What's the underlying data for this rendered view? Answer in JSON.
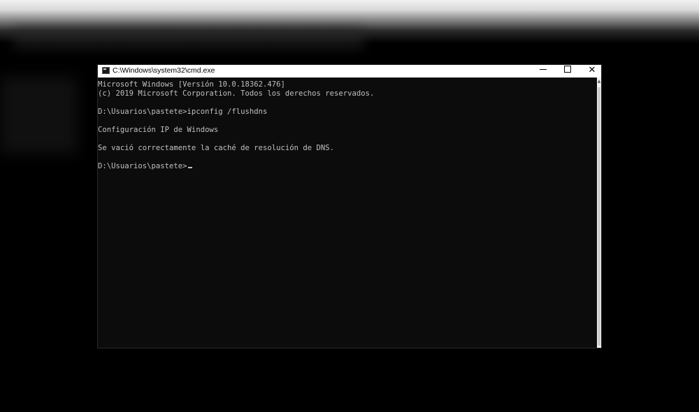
{
  "window": {
    "title": "C:\\Windows\\system32\\cmd.exe",
    "icon": "cmd-icon"
  },
  "caption_buttons": {
    "minimize_glyph": "",
    "maximize_glyph": "",
    "close_glyph": "✕"
  },
  "console": {
    "lines": [
      "Microsoft Windows [Versión 10.0.18362.476]",
      "(c) 2019 Microsoft Corporation. Todos los derechos reservados.",
      "",
      "D:\\Usuarios\\pastete>ipconfig /flushdns",
      "",
      "Configuración IP de Windows",
      "",
      "Se vació correctamente la caché de resolución de DNS.",
      "",
      "D:\\Usuarios\\pastete>"
    ]
  },
  "colors": {
    "console_bg": "#0c0c0c",
    "console_text": "#c0c0c0",
    "titlebar_bg": "#ffffff"
  }
}
